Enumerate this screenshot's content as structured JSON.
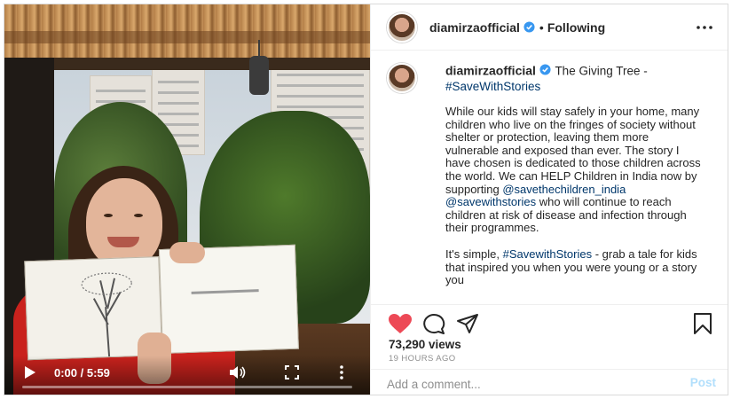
{
  "colors": {
    "accent": "#0095f6",
    "link": "#00376b",
    "like_red": "#ed4956",
    "verified_blue": "#3897f0",
    "muted": "#8e8e8e",
    "post_disabled": "#b2dffc"
  },
  "video": {
    "time_label": "0:00 / 5:59",
    "progress_fraction": 0.0,
    "icons": [
      "play-icon",
      "volume-icon",
      "fullscreen-icon",
      "more-vertical-icon"
    ]
  },
  "header": {
    "username": "diamirzaofficial",
    "separator": "•",
    "follow_state": "Following",
    "icons": [
      "avatar",
      "verified-icon",
      "more-horizontal-icon"
    ]
  },
  "caption": {
    "username": "diamirzaofficial",
    "title": "The Giving Tree -",
    "hashtag": "#SaveWithStories",
    "p1_text_a": "While our kids will stay safely in your home, many children who live on the fringes of society without shelter or protection, leaving them more vulnerable and exposed than ever. The story I have chosen is dedicated to those children across the world. We can HELP Children in India now by supporting",
    "mention1": "@savethechildren_india",
    "mention2": "@savewithstories",
    "p1_text_b": "who will continue to reach children at risk of disease and infection through their programmes.",
    "p2_text_a": "It's simple,",
    "p2_hashtag": "#SavewithStories",
    "p2_text_b": "- grab a tale for kids that inspired you when you were young or a story you"
  },
  "actions": {
    "icons": [
      "heart-icon",
      "comment-icon",
      "share-icon",
      "bookmark-icon"
    ],
    "liked": true,
    "views": "73,290 views",
    "posted_ago": "19 HOURS AGO"
  },
  "comment": {
    "placeholder": "Add a comment...",
    "post_label": "Post"
  }
}
